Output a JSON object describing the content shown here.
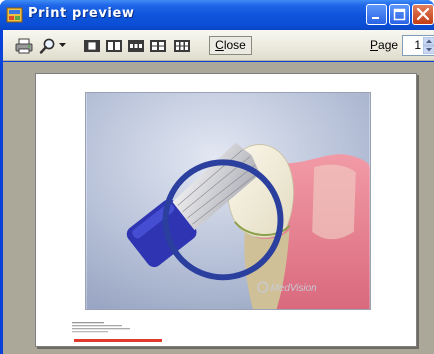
{
  "window": {
    "title": "Print preview",
    "title_color": "#ffffff",
    "titlebar_color": "#0b4fd6"
  },
  "toolbar": {
    "print_icon": "printer-icon",
    "zoom_icon": "magnifier-icon",
    "zoom_dropdown_icon": "dropdown-arrow-icon",
    "page_layout_icons": [
      "one-page-icon",
      "two-pages-icon",
      "three-pages-icon",
      "four-pages-icon",
      "six-pages-icon"
    ],
    "close_label": "Close",
    "close_accel": "C",
    "close_rest": "lose",
    "page_label": "Page",
    "page_accel": "P",
    "page_rest": "age",
    "page_value": "1"
  },
  "document": {
    "watermark": "MedVision",
    "caption": "                              ",
    "accent_color": "#e03a2c",
    "ring_color": "#2a3f9e"
  }
}
